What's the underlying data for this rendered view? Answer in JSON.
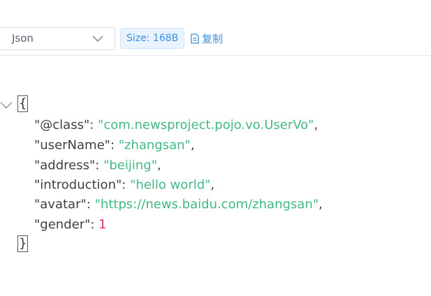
{
  "toolbar": {
    "format_value": "Json",
    "size_label": "Size: 168B",
    "copy_label": "复制"
  },
  "json": {
    "open_brace": "{",
    "close_brace": "}",
    "colon": ": ",
    "comma": ",",
    "entries": [
      {
        "key": "\"@class\"",
        "value": "\"com.newsproject.pojo.vo.UserVo\"",
        "type": "string"
      },
      {
        "key": "\"userName\"",
        "value": "\"zhangsan\"",
        "type": "string"
      },
      {
        "key": "\"address\"",
        "value": "\"beijing\"",
        "type": "string"
      },
      {
        "key": "\"introduction\"",
        "value": "\"hello world\"",
        "type": "string"
      },
      {
        "key": "\"avatar\"",
        "value": "\"https://news.baidu.com/zhangsan\"",
        "type": "string"
      },
      {
        "key": "\"gender\"",
        "value": "1",
        "type": "number"
      }
    ]
  },
  "colors": {
    "accent": "#3d8fe0",
    "string": "#42b883",
    "number": "#e6356b",
    "text": "#3b3f46"
  },
  "icons": {
    "select_chevron": "chevron-down-icon",
    "copy": "document-icon",
    "collapse": "chevron-down-icon"
  }
}
